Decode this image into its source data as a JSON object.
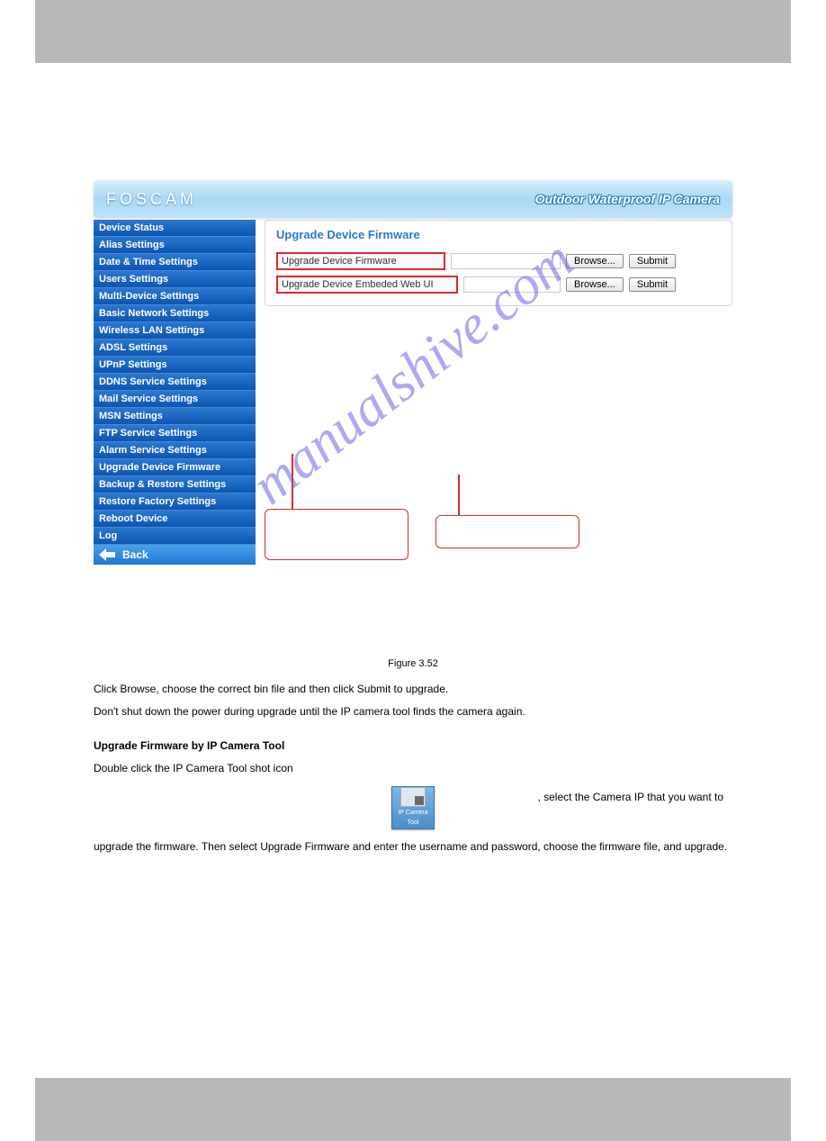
{
  "watermark": "manualshive.com",
  "header": {
    "logo": "FOSCAM",
    "tagline": "Outdoor Waterproof IP Camera"
  },
  "sidebar": {
    "items": [
      "Device Status",
      "Alias Settings",
      "Date & Time Settings",
      "Users Settings",
      "Multi-Device Settings",
      "Basic Network Settings",
      "Wireless LAN Settings",
      "ADSL Settings",
      "UPnP Settings",
      "DDNS Service Settings",
      "Mail Service Settings",
      "MSN Settings",
      "FTP Service Settings",
      "Alarm Service Settings",
      "Upgrade Device Firmware",
      "Backup & Restore Settings",
      "Restore Factory Settings",
      "Reboot Device",
      "Log"
    ],
    "back": "Back"
  },
  "panel": {
    "title": "Upgrade Device Firmware",
    "row1_label": "Upgrade Device Firmware",
    "row2_label": "Upgrade Device Embeded Web UI",
    "browse_label": "Browse...",
    "submit_label": "Submit"
  },
  "callouts": {
    "left": "",
    "right": ""
  },
  "figure_caption": "Figure 3.52",
  "body": {
    "p1": "Click Browse, choose the correct bin file and then click Submit to upgrade.",
    "p2": "Don't shut down the power during upgrade until the IP camera tool finds the camera again.",
    "h_upgrade": "Upgrade Firmware by IP Camera Tool",
    "p3_a": "Double click the IP Camera Tool shot icon ",
    "p3_b": ", select the Camera IP that you want to",
    "p4": "upgrade the firmware. Then select Upgrade Firmware and enter the username and password, choose the firmware file, and upgrade.",
    "icon_label": "IP Camera\nTool"
  }
}
